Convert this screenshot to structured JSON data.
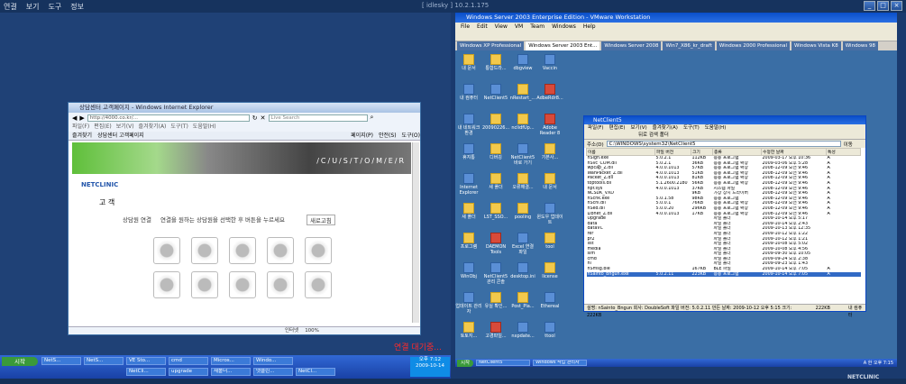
{
  "host": {
    "menu": [
      "연결",
      "보기",
      "도구",
      "정보"
    ],
    "title": "[ idlesky ] 10.2.1.175",
    "controls": [
      "_",
      "□",
      "×"
    ]
  },
  "ie": {
    "title": "상담센터 고객페이지 - Windows Internet Explorer",
    "url": "http://4000.co.kr/...",
    "search_placeholder": "Live Search",
    "menubar": [
      "파일(F)",
      "편집(E)",
      "보기(V)",
      "즐겨찾기(A)",
      "도구(T)",
      "도움말(H)"
    ],
    "tabs": [
      "즐겨찾기",
      "상담센터 고객페이지"
    ],
    "page_menu": [
      "페이지(P)",
      "안전(S)",
      "도구(O)"
    ],
    "banner_text": "/C/U/S/T/O/M/E/R",
    "logo": "NETCLINIC",
    "section_title": "고 객",
    "consult_label": "상담원 연결",
    "consult_text": "연결을 원하는 상담원을 선택한 후 버튼을 누르세요",
    "refresh_label": "새로고침",
    "status_zone": "인터넷",
    "zoom": "100%"
  },
  "left_red_text": "연결 대기중...",
  "left_taskbar": {
    "start": "시작",
    "row1": [
      "NetS...",
      "NetS...",
      "VE Sto...",
      "cmd",
      "Micros...",
      "Windo..."
    ],
    "row2": [
      "NetCli...",
      "upgrade",
      "새폴더...",
      "넷클린...",
      "NetCl..."
    ],
    "clock_time": "오후 7:12",
    "clock_date": "2009-10-14"
  },
  "vmware": {
    "title": "Windows Server 2003 Enterprise Edition - VMware Workstation",
    "menu": [
      "File",
      "Edit",
      "View",
      "VM",
      "Team",
      "Windows",
      "Help"
    ],
    "tabs": [
      "Windows XP Professional",
      "Windows Server 2003 Ent...",
      "Windows Server 2008",
      "Win7_X86_kr_draft",
      "Windows 2000 Professional",
      "Windows Vista K8",
      "Windows 98"
    ],
    "active_tab": 1
  },
  "desktop_icons": [
    {
      "label": "내 문서",
      "style": "yellow"
    },
    {
      "label": "통합드라...",
      "style": "yellow"
    },
    {
      "label": "dbgview",
      "style": "blue"
    },
    {
      "label": "Vaccin",
      "style": "blue"
    },
    {
      "label": "내 컴퓨터",
      "style": "blue"
    },
    {
      "label": "NetClient5",
      "style": "blue"
    },
    {
      "label": "nRestart_...",
      "style": "yellow"
    },
    {
      "label": "AdbeRdr8...",
      "style": "red"
    },
    {
      "label": "내 네트워크 환경",
      "style": "blue"
    },
    {
      "label": "20090226...",
      "style": "yellow"
    },
    {
      "label": "nclidfUp...",
      "style": "yellow"
    },
    {
      "label": "Adobe Reader 8",
      "style": "red"
    },
    {
      "label": "휴지통",
      "style": "blue"
    },
    {
      "label": "디버깅",
      "style": "yellow"
    },
    {
      "label": "NetClient5 바로 가기",
      "style": "blue"
    },
    {
      "label": "기본사...",
      "style": "yellow"
    },
    {
      "label": "Internet Explorer",
      "style": "blue"
    },
    {
      "label": "새 폴더",
      "style": "yellow"
    },
    {
      "label": "오류해결...",
      "style": "yellow"
    },
    {
      "label": "내 문서",
      "style": "yellow"
    },
    {
      "label": "새 폴더",
      "style": "yellow"
    },
    {
      "label": "LST_SSO...",
      "style": "yellow"
    },
    {
      "label": "pooling",
      "style": "yellow"
    },
    {
      "label": "윈도우 업데이트",
      "style": "blue"
    },
    {
      "label": "프로그램",
      "style": "yellow"
    },
    {
      "label": "DAEMON Tools",
      "style": "red"
    },
    {
      "label": "Excel 연결 파일",
      "style": "blue"
    },
    {
      "label": "tool",
      "style": "yellow"
    },
    {
      "label": "WinObj",
      "style": "blue"
    },
    {
      "label": "NetClient5 관리 콘솔",
      "style": "blue"
    },
    {
      "label": "desktop.ini",
      "style": "blue"
    },
    {
      "label": "license",
      "style": "yellow"
    },
    {
      "label": "업데이트 관리자",
      "style": "blue"
    },
    {
      "label": "유실 확인...",
      "style": "yellow"
    },
    {
      "label": "Post_Pla...",
      "style": "yellow"
    },
    {
      "label": "Ethereal",
      "style": "blue"
    },
    {
      "label": "토토지...",
      "style": "yellow"
    },
    {
      "label": "고경파일...",
      "style": "red"
    },
    {
      "label": "nxpdate...",
      "style": "blue"
    },
    {
      "label": "ttool",
      "style": "blue"
    }
  ],
  "netclient": {
    "title": "NetClient5",
    "menu": [
      "파일(F)",
      "편집(E)",
      "보기(V)",
      "즐겨찾기(A)",
      "도구(T)",
      "도움말(H)"
    ],
    "toolbar": [
      "뒤로",
      "검색",
      "폴더"
    ],
    "address_label": "주소(D)",
    "address": "C:\\WINDOWS\\system32\\NetClient5",
    "go": "이동",
    "columns": [
      "이름",
      "파일 버전",
      "크기",
      "종류",
      "수정한 날짜",
      "특성"
    ],
    "rows": [
      [
        "nSign.exe",
        "5.0.2.1",
        "112KB",
        "응용 프로그램",
        "2009-03-17 오후 10:36",
        "A"
      ],
      [
        "nSvc_COM.dll",
        "5.0.2.1",
        "36KB",
        "응용 프로그램 확장",
        "2009-03-06 오후 5:28",
        "A"
      ],
      [
        "wpcap_Z.dll",
        "4.0.0.1013",
        "57KB",
        "응용 프로그램 확장",
        "2008-12-09 오전 9:46",
        "A"
      ],
      [
        "WanPacket_Z.dll",
        "4.0.0.1013",
        "51KB",
        "응용 프로그램 확장",
        "2008-12-09 오전 9:46",
        "A"
      ],
      [
        "Packet_Z.dll",
        "4.0.0.1013",
        "81KB",
        "응용 프로그램 확장",
        "2008-12-09 오전 9:46",
        "A"
      ],
      [
        "toptools.dll",
        "5.1.2600.2180",
        "56KB",
        "응용 프로그램 확장",
        "2008-12-09 오전 9:46",
        "A"
      ],
      [
        "npf.sys",
        "4.0.0.1013",
        "37KB",
        "시스템 파일",
        "2008-12-09 오전 9:46",
        "A"
      ],
      [
        "NCSDK_VXD",
        "",
        "9KB",
        "가상 장치 드라이버",
        "2008-12-09 오전 9:46",
        "A"
      ],
      [
        "nSchk.exe",
        "5.0.1.58",
        "98KB",
        "응용 프로그램",
        "2008-12-09 오전 9:46",
        "A"
      ],
      [
        "nScnl.dll",
        "5.0.0.1",
        "76KB",
        "응용 프로그램 확장",
        "2008-12-09 오전 9:46",
        "A"
      ],
      [
        "nSed.dll",
        "5.0.0.20",
        "296KB",
        "응용 프로그램 확장",
        "2008-12-09 오전 9:46",
        "A"
      ],
      [
        "Libnet_Z.dll",
        "4.0.0.1013",
        "17KB",
        "응용 프로그램 확장",
        "2008-12-09 오전 9:46",
        "A"
      ],
      [
        "Upgrade",
        "",
        "",
        "파일 폴더",
        "2009-10-14 오후 5:17",
        ""
      ],
      [
        "data",
        "",
        "",
        "파일 폴더",
        "2009-10-14 오후 2:43",
        ""
      ],
      [
        "dataVC",
        "",
        "",
        "파일 폴더",
        "2009-10-13 오후 12:35",
        ""
      ],
      [
        "rer",
        "",
        "",
        "파일 폴더",
        "2009-10-12 오후 1:22",
        ""
      ],
      [
        "pr2",
        "",
        "",
        "파일 폴더",
        "2009-10-12 오후 1:21",
        ""
      ],
      [
        "list",
        "",
        "",
        "파일 폴더",
        "2009-10-08 오후 5:02",
        ""
      ],
      [
        "media",
        "",
        "",
        "파일 폴더",
        "2009-10-08 오후 4:56",
        ""
      ],
      [
        "sim",
        "",
        "",
        "파일 폴더",
        "2009-09-30 오후 10:05",
        ""
      ],
      [
        "cmd",
        "",
        "",
        "파일 폴더",
        "2009-09-24 오후 2:38",
        ""
      ],
      [
        "nl",
        "",
        "",
        "파일 폴더",
        "2009-09-23 오후 1:43",
        ""
      ],
      [
        "nSmsg.ble",
        "",
        "167KB",
        "BLE 파일",
        "2009-10-14 오후 7:05",
        "A"
      ],
      [
        "nSainto_Bngun.exe",
        "5.0.2.11",
        "223KB",
        "응용 프로그램",
        "2009-10-14 오후 7:05",
        "A"
      ]
    ],
    "selected_row": 23,
    "status": "설명: nSainto_Bngun 회사: DoubleSoft 파일 버전: 5.0.2.11 만든 날짜: 2009-10-12 오후 5:15 크기: 222KB",
    "status_size": "222KB",
    "status_zone": "내 컴퓨터"
  },
  "guest_taskbar": {
    "start": "시작",
    "items": [
      "NetClient5",
      "Windows 작업 관리자"
    ],
    "clock": "A 한 오후 7:15"
  },
  "wallpaper_brand": "NETCLINIC"
}
